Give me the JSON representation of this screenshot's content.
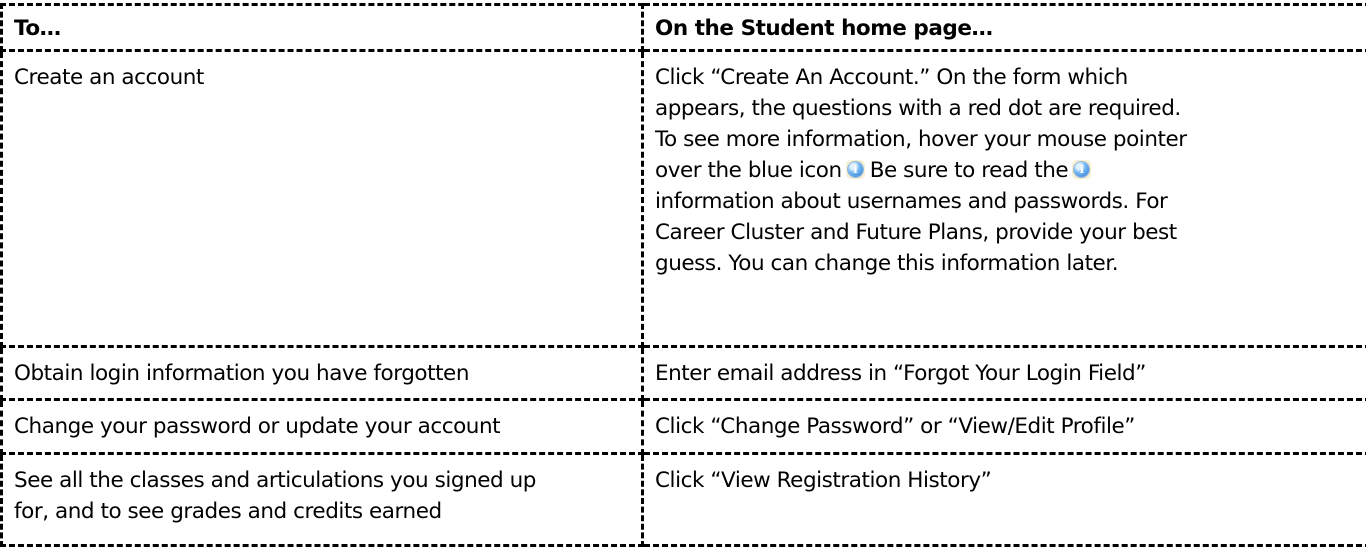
{
  "table": {
    "headers": {
      "col1": "To…",
      "col2": "On the Student home page…"
    },
    "rows": [
      {
        "task": "Create an account",
        "instruction_lines": [
          "Click “Create An Account.” On the form which",
          "appears, the questions with a red dot are required.",
          "To see more information, hover your mouse pointer",
          "over the blue icon",
          "Be sure to read the",
          "information about usernames and passwords. For",
          "Career Cluster and Future Plans, provide your best",
          "guess.  You can change this information later."
        ]
      },
      {
        "task": "Obtain login information you have forgotten",
        "instruction": "Enter email address in “Forgot Your Login Field”"
      },
      {
        "task": "Change your password or update your account",
        "instruction": "Click “Change Password” or “View/Edit Profile”"
      },
      {
        "task_lines": [
          "See all the classes and articulations you signed up",
          "for, and to see grades and credits earned"
        ],
        "instruction": "Click “View Registration History”"
      }
    ]
  },
  "icons": {
    "info": "info-icon"
  },
  "colors": {
    "border": "#000000",
    "text": "#000000",
    "background": "#ffffff",
    "icon_blue": "#2f77d0"
  }
}
